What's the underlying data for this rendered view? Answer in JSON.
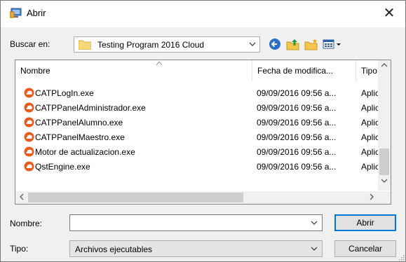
{
  "window": {
    "title": "Abrir",
    "close_glyph": "✕"
  },
  "lookin": {
    "label": "Buscar en:",
    "value": "Testing Program 2016 Cloud"
  },
  "toolbar": {
    "icons": [
      "back-icon",
      "up-folder-icon",
      "new-folder-icon",
      "view-menu-icon"
    ]
  },
  "list": {
    "columns": [
      "Nombre",
      "Fecha de modifica...",
      "Tipo"
    ],
    "rows": [
      {
        "name": "CATPLogIn.exe",
        "date": "09/09/2016 09:56 a...",
        "type": "Aplic"
      },
      {
        "name": "CATPPanelAdministrador.exe",
        "date": "09/09/2016 09:56 a...",
        "type": "Aplic"
      },
      {
        "name": "CATPPanelAlumno.exe",
        "date": "09/09/2016 09:56 a...",
        "type": "Aplic"
      },
      {
        "name": "CATPPanelMaestro.exe",
        "date": "09/09/2016 09:56 a...",
        "type": "Aplic"
      },
      {
        "name": "Motor de actualizacion.exe",
        "date": "09/09/2016 09:56 a...",
        "type": "Aplic"
      },
      {
        "name": "QstEngine.exe",
        "date": "09/09/2016 09:56 a...",
        "type": "Aplic"
      }
    ]
  },
  "filename": {
    "label": "Nombre:",
    "value": "",
    "placeholder": ""
  },
  "filetype": {
    "label": "Tipo:",
    "value": "Archivos ejecutables"
  },
  "buttons": {
    "open": "Abrir",
    "cancel": "Cancelar"
  },
  "colors": {
    "accent": "#0078d7",
    "exe_icon": "#ea5a1c"
  }
}
